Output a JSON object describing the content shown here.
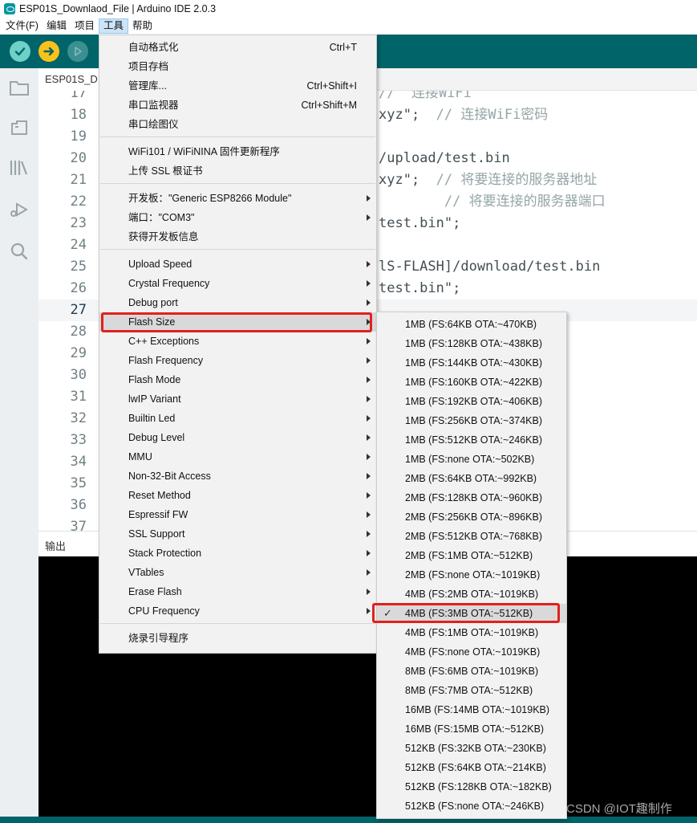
{
  "window": {
    "title": "ESP01S_Downlaod_File | Arduino IDE 2.0.3"
  },
  "menubar": {
    "items": [
      "文件(F)",
      "编辑",
      "项目",
      "工具",
      "帮助"
    ],
    "active_index": 3
  },
  "toolbar": {
    "verify": "verify-icon",
    "upload": "upload-arrow-icon",
    "debug": "debug-play-icon"
  },
  "sidebar": {
    "icons": [
      "folder-icon",
      "board-manager-icon",
      "library-icon",
      "debug-icon",
      "search-icon"
    ]
  },
  "editor": {
    "tab_label": "ESP01S_D",
    "lines": [
      {
        "n": "17",
        "code": "",
        "comment": "//  连接WiFi",
        "current": false
      },
      {
        "n": "18",
        "code": "xyz\";  ",
        "comment": "// 连接WiFi密码",
        "current": false
      },
      {
        "n": "19",
        "code": "",
        "comment": "",
        "current": false
      },
      {
        "n": "20",
        "code": "/upload/test.bin",
        "comment": "",
        "current": false
      },
      {
        "n": "21",
        "code": "xyz\";  ",
        "comment": "// 将要连接的服务器地址",
        "current": false
      },
      {
        "n": "22",
        "code": "        ",
        "comment": "// 将要连接的服务器端口",
        "current": false
      },
      {
        "n": "23",
        "code": "test.bin\";",
        "comment": "",
        "current": false
      },
      {
        "n": "24",
        "code": "",
        "comment": "",
        "current": false
      },
      {
        "n": "25",
        "code": "lS-FLASH]/download/test.bin",
        "comment": "",
        "current": false
      },
      {
        "n": "26",
        "code": "test.bin\";",
        "comment": "",
        "current": false
      },
      {
        "n": "27",
        "code": "",
        "comment": "",
        "current": true
      },
      {
        "n": "28",
        "code": "",
        "comment": "",
        "current": false
      },
      {
        "n": "29",
        "code": "",
        "comment": "",
        "current": false
      },
      {
        "n": "30",
        "code": "",
        "comment": "",
        "current": false
      },
      {
        "n": "31",
        "code": "",
        "comment": "",
        "current": false
      },
      {
        "n": "32",
        "code": "",
        "comment": "",
        "current": false
      },
      {
        "n": "33",
        "code": "",
        "comment": "",
        "current": false
      },
      {
        "n": "34",
        "code": "",
        "comment": "",
        "current": false
      },
      {
        "n": "35",
        "code": "",
        "comment": "",
        "current": false
      },
      {
        "n": "36",
        "code": "",
        "comment": "",
        "current": false
      },
      {
        "n": "37",
        "code": "",
        "comment": "",
        "current": false
      }
    ]
  },
  "output": {
    "title": "输出"
  },
  "tools_menu": {
    "groups": [
      [
        {
          "label": "自动格式化",
          "shortcut": "Ctrl+T"
        },
        {
          "label": "项目存档",
          "shortcut": ""
        },
        {
          "label": "管理库...",
          "shortcut": "Ctrl+Shift+I"
        },
        {
          "label": "串口监视器",
          "shortcut": "Ctrl+Shift+M"
        },
        {
          "label": "串口绘图仪",
          "shortcut": ""
        }
      ],
      [
        {
          "label": "WiFi101 / WiFiNINA 固件更新程序",
          "shortcut": ""
        },
        {
          "label": "上传 SSL 根证书",
          "shortcut": ""
        }
      ],
      [
        {
          "label": "开发板：\"Generic ESP8266 Module\"",
          "submenu": true
        },
        {
          "label": "端口：\"COM3\"",
          "submenu": true
        },
        {
          "label": "获得开发板信息",
          "submenu": false
        }
      ],
      [
        {
          "label": "Upload Speed",
          "submenu": true
        },
        {
          "label": "Crystal Frequency",
          "submenu": true
        },
        {
          "label": "Debug port",
          "submenu": true
        },
        {
          "label": "Flash Size",
          "submenu": true,
          "highlighted": true
        },
        {
          "label": "C++ Exceptions",
          "submenu": true
        },
        {
          "label": "Flash Frequency",
          "submenu": true
        },
        {
          "label": "Flash Mode",
          "submenu": true
        },
        {
          "label": "lwIP Variant",
          "submenu": true
        },
        {
          "label": "Builtin Led",
          "submenu": true
        },
        {
          "label": "Debug Level",
          "submenu": true
        },
        {
          "label": "MMU",
          "submenu": true
        },
        {
          "label": "Non-32-Bit Access",
          "submenu": true
        },
        {
          "label": "Reset Method",
          "submenu": true
        },
        {
          "label": "Espressif FW",
          "submenu": true
        },
        {
          "label": "SSL Support",
          "submenu": true
        },
        {
          "label": "Stack Protection",
          "submenu": true
        },
        {
          "label": "VTables",
          "submenu": true
        },
        {
          "label": "Erase Flash",
          "submenu": true
        },
        {
          "label": "CPU Frequency",
          "submenu": true
        }
      ],
      [
        {
          "label": "烧录引导程序",
          "submenu": false
        }
      ]
    ]
  },
  "flash_size_menu": {
    "selected_index": 15,
    "options": [
      "1MB (FS:64KB OTA:~470KB)",
      "1MB (FS:128KB OTA:~438KB)",
      "1MB (FS:144KB OTA:~430KB)",
      "1MB (FS:160KB OTA:~422KB)",
      "1MB (FS:192KB OTA:~406KB)",
      "1MB (FS:256KB OTA:~374KB)",
      "1MB (FS:512KB OTA:~246KB)",
      "1MB (FS:none OTA:~502KB)",
      "2MB (FS:64KB OTA:~992KB)",
      "2MB (FS:128KB OTA:~960KB)",
      "2MB (FS:256KB OTA:~896KB)",
      "2MB (FS:512KB OTA:~768KB)",
      "2MB (FS:1MB OTA:~512KB)",
      "2MB (FS:none OTA:~1019KB)",
      "4MB (FS:2MB OTA:~1019KB)",
      "4MB (FS:3MB OTA:~512KB)",
      "4MB (FS:1MB OTA:~1019KB)",
      "4MB (FS:none OTA:~1019KB)",
      "8MB (FS:6MB OTA:~1019KB)",
      "8MB (FS:7MB OTA:~512KB)",
      "16MB (FS:14MB OTA:~1019KB)",
      "16MB (FS:15MB OTA:~512KB)",
      "512KB (FS:32KB OTA:~230KB)",
      "512KB (FS:64KB OTA:~214KB)",
      "512KB (FS:128KB OTA:~182KB)",
      "512KB (FS:none OTA:~246KB)"
    ]
  },
  "watermark": "CSDN @IOT趣制作",
  "colors": {
    "toolbar_bg": "#006468",
    "verify": "#6ed0c7",
    "upload": "#f9c21b",
    "highlight_box": "#e1211e"
  }
}
